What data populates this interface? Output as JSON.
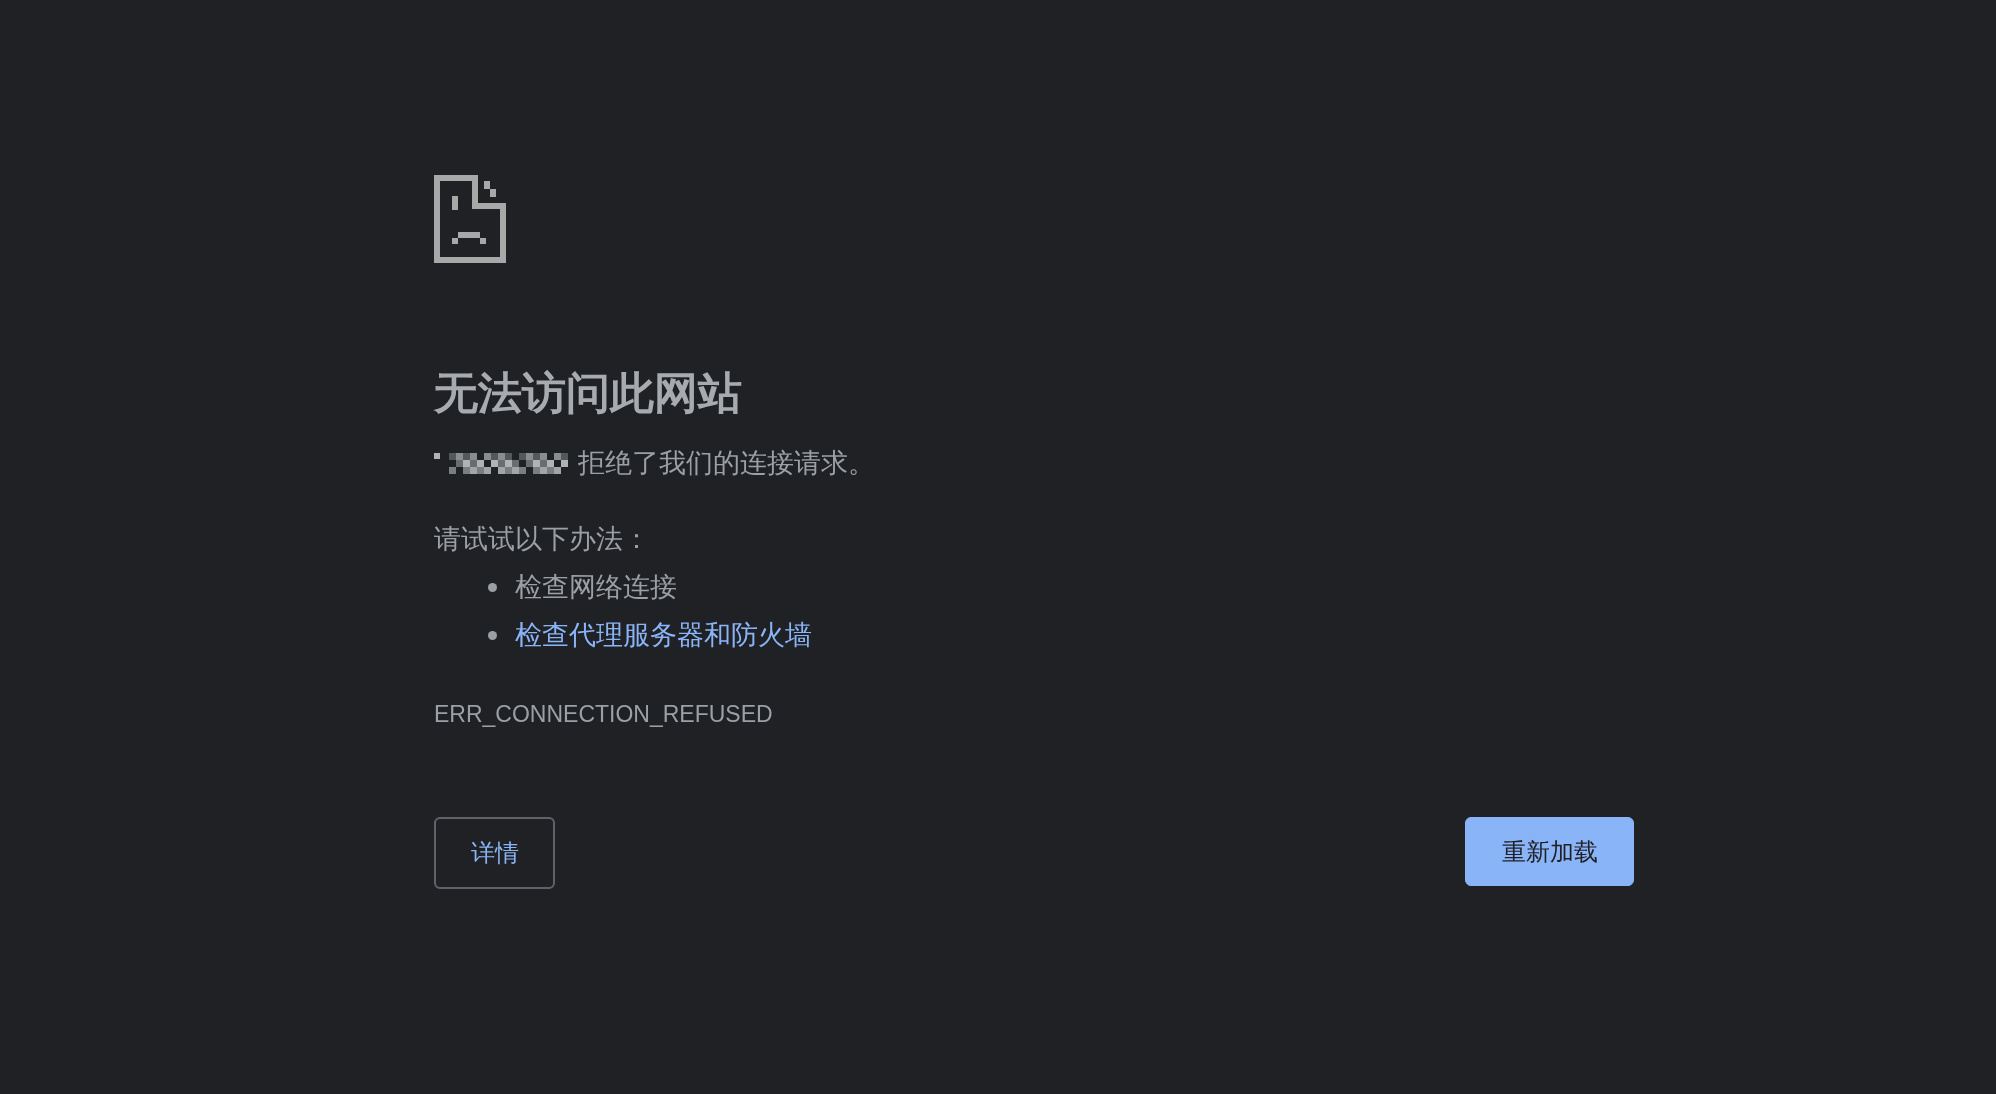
{
  "error_page": {
    "title": "无法访问此网站",
    "message": "拒绝了我们的连接请求。",
    "suggestions_heading": "请试试以下办法：",
    "suggestions": [
      {
        "text": "检查网络连接",
        "kind": "text"
      },
      {
        "text": "检查代理服务器和防火墙",
        "kind": "link"
      }
    ],
    "error_code": "ERR_CONNECTION_REFUSED",
    "buttons": [
      {
        "label": "详情",
        "kind": "secondary"
      },
      {
        "label": "重新加载",
        "kind": "primary"
      }
    ]
  }
}
